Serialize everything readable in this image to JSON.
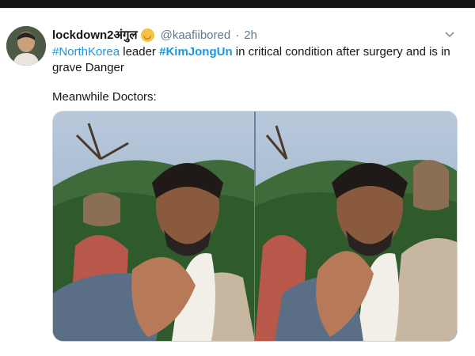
{
  "tweet": {
    "display_name": "lockdown2अंगुल",
    "handle": "@kaafiibored",
    "separator": "·",
    "time": "2h",
    "body": {
      "tag1": "#NorthKorea",
      "word_leader": "leader",
      "tag2": "#KimJongUn",
      "rest": "in critical condition after surgery and is in grave Danger"
    },
    "second_line": "Meanwhile Doctors:"
  },
  "icons": {
    "verified_emoji": "face-emoji-icon",
    "menu": "chevron-down-icon"
  },
  "colors": {
    "link": "#1b95e0",
    "text": "#14171a",
    "muted": "#657786"
  }
}
